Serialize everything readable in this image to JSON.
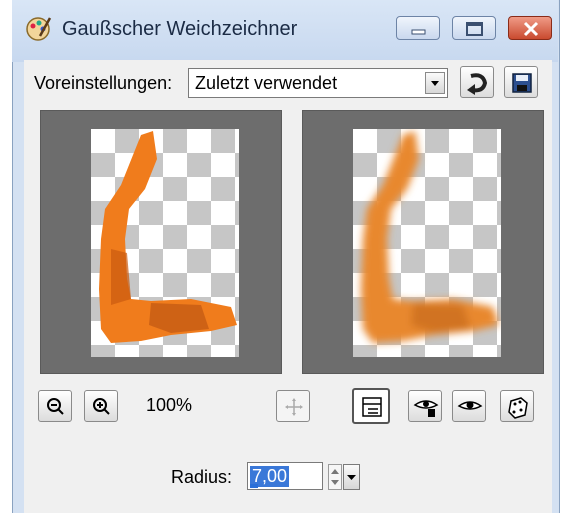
{
  "window": {
    "title": "Gaußscher Weichzeichner",
    "buttons": {
      "minimize": "minimize-icon",
      "maximize": "maximize-icon",
      "close": "close-icon"
    }
  },
  "presets": {
    "label": "Voreinstellungen:",
    "value": "Zuletzt verwendet",
    "reset_icon": "reset-icon",
    "save_icon": "save-icon"
  },
  "preview": {
    "zoom": "100%",
    "tools": [
      "zoom-out-icon",
      "zoom-in-icon",
      "pan-icon",
      "proof-icon",
      "auto-proof-icon",
      "show-preview-icon",
      "randomize-icon"
    ]
  },
  "radius": {
    "label": "Radius:",
    "value": "7,00"
  },
  "colors": {
    "titlebar": "#c7d8ef",
    "dialog_bg": "#f0f0f0",
    "preview_bg": "#6d6d6d",
    "accent": "#f07c1c",
    "close": "#c94a2f"
  }
}
